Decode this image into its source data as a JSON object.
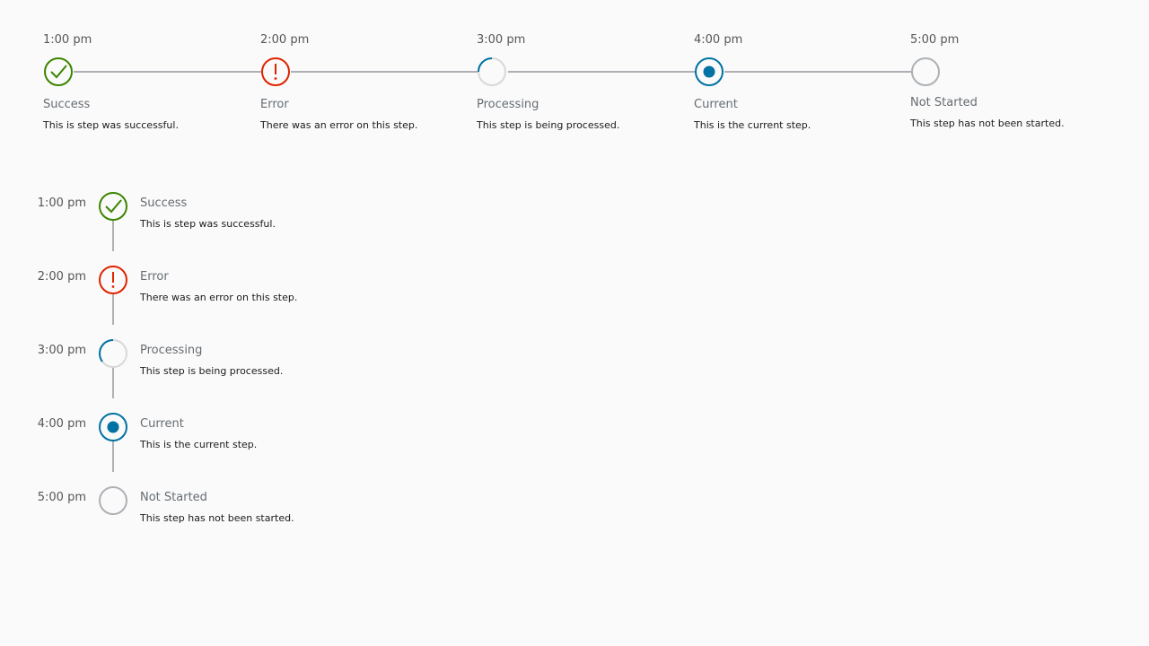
{
  "steps": [
    {
      "time": "1:00 pm",
      "title": "Success",
      "description": "This is step was successful.",
      "state": "success",
      "icon": "checkmark-circle-icon"
    },
    {
      "time": "2:00 pm",
      "title": "Error",
      "description": "There was an error on this step.",
      "state": "error",
      "icon": "exclamation-circle-icon"
    },
    {
      "time": "3:00 pm",
      "title": "Processing",
      "description": "This step is being processed.",
      "state": "processing",
      "icon": "spinner-icon"
    },
    {
      "time": "4:00 pm",
      "title": "Current",
      "description": "This is the current step.",
      "state": "current",
      "icon": "dot-circle-icon"
    },
    {
      "time": "5:00 pm",
      "title": "Not Started",
      "description": "This step has not been started.",
      "state": "not-started",
      "icon": "empty-circle-icon"
    }
  ],
  "colors": {
    "success": "#3c8500",
    "error": "#e12200",
    "processing": "#0072a3",
    "current": "#0072a3",
    "not_started": "#adb1b5",
    "connector": "#adb1b5"
  }
}
